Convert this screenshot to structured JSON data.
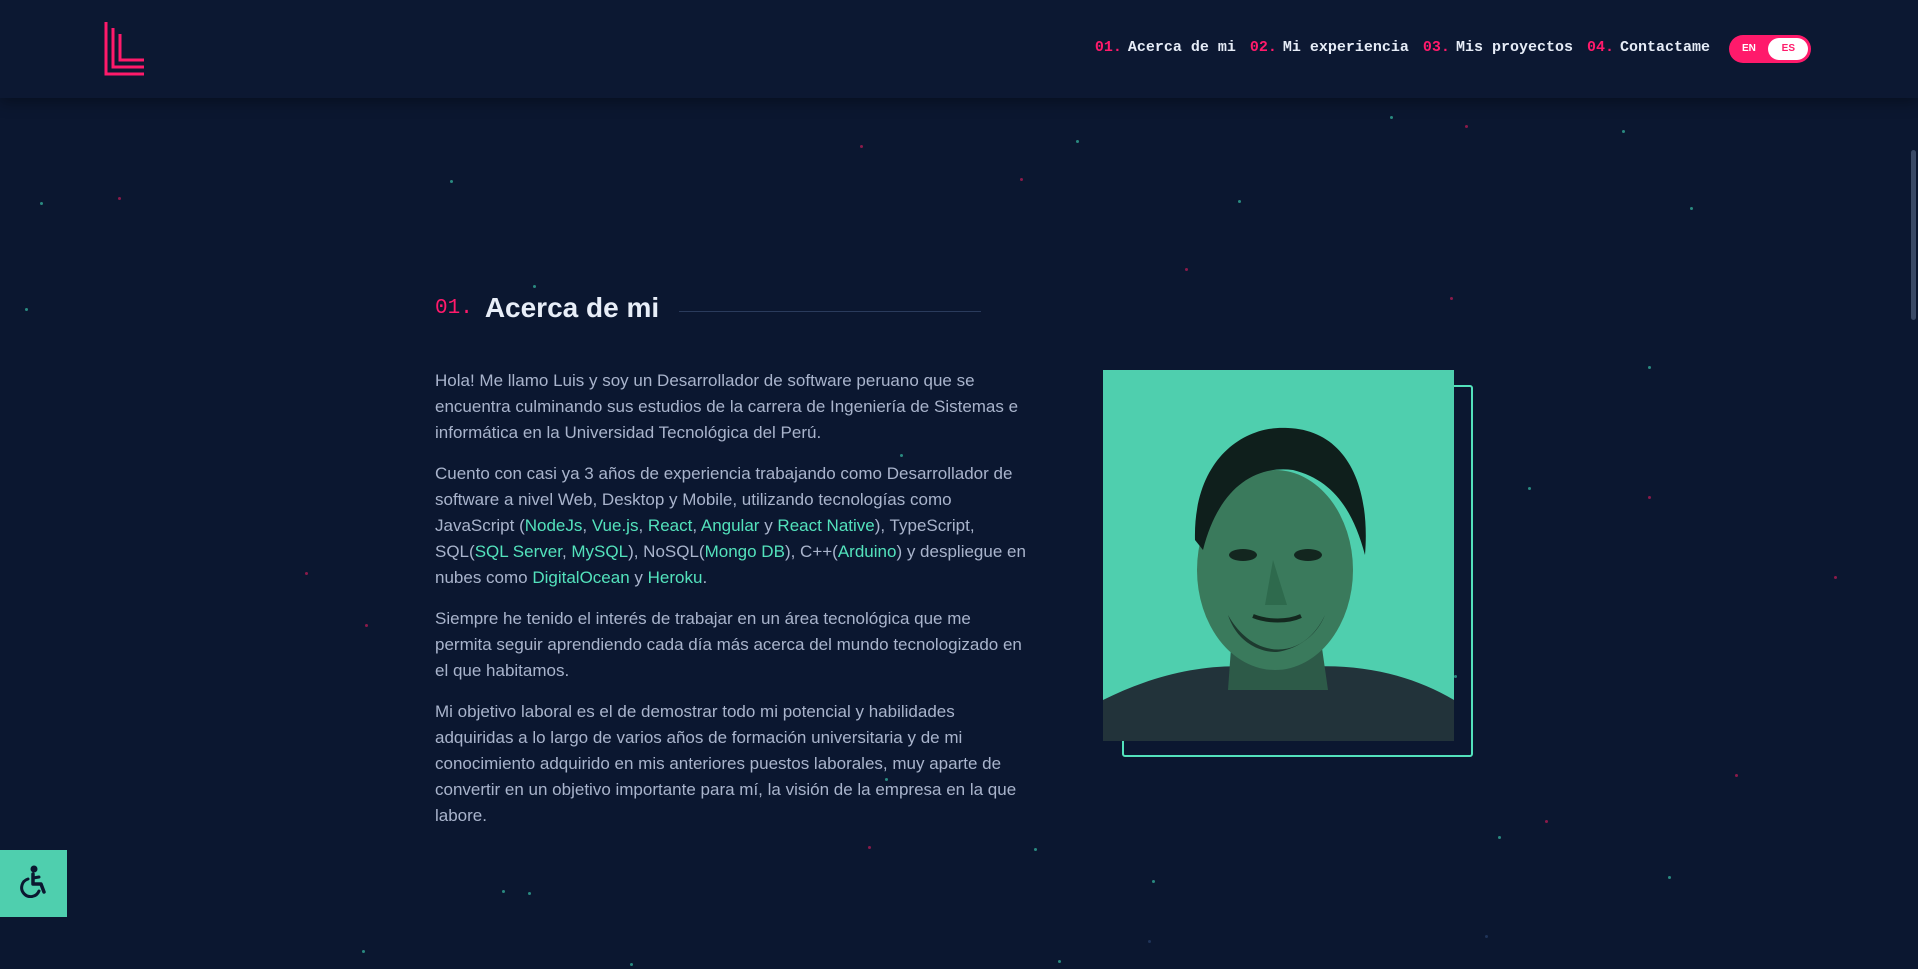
{
  "nav": {
    "items": [
      {
        "num": "01.",
        "label": "Acerca de mi"
      },
      {
        "num": "02.",
        "label": "Mi experiencia"
      },
      {
        "num": "03.",
        "label": "Mis proyectos"
      },
      {
        "num": "04.",
        "label": "Contactame"
      }
    ],
    "lang": {
      "en": "EN",
      "es": "ES",
      "selected": "ES"
    }
  },
  "about": {
    "num": "01.",
    "title": "Acerca de mi",
    "p1": "Hola! Me llamo Luis y soy un Desarrollador de software peruano que se encuentra culminando sus estudios de la carrera de Ingeniería de Sistemas e informática en la Universidad Tecnológica del Perú.",
    "p2": {
      "intro": "Cuento con casi ya 3 años de experiencia trabajando como Desarrollador de software a nivel Web, Desktop y Mobile, utilizando tecnologías como JavaScript (",
      "t1": "NodeJs",
      "t2": "Vue.js",
      "t3": "React",
      "t4": "Angular",
      "y1": " y ",
      "t5": "React Native",
      "mid1": "), TypeScript, SQL(",
      "t6": "SQL Server",
      "t7": "MySQL",
      "mid2": "), NoSQL(",
      "t8": "Mongo DB",
      "mid3": "), C++(",
      "t9": "Arduino",
      "mid4": ") y despliegue en nubes como ",
      "t10": "DigitalOcean",
      "y2": " y ",
      "t11": "Heroku",
      "end": "."
    },
    "p3": "Siempre he tenido el interés de trabajar en un área tecnológica que me permita seguir aprendiendo cada día más acerca del mundo tecnologizado en el que habitamos.",
    "p4": "Mi objetivo laboral es el de demostrar todo mi potencial y habilidades adquiridas a lo largo de varios años de formación universitaria y de mi conocimiento adquirido en mis anteriores puestos laborales, muy aparte de convertir en un objetivo importante para mí, la visión de la empresa en la que labore."
  },
  "icons": {
    "logo": "ll-logo-icon",
    "accessibility": "wheelchair-icon"
  },
  "colors": {
    "background": "#0b1730",
    "accent_pink": "#ff1a6b",
    "accent_teal": "#53e2bc"
  }
}
